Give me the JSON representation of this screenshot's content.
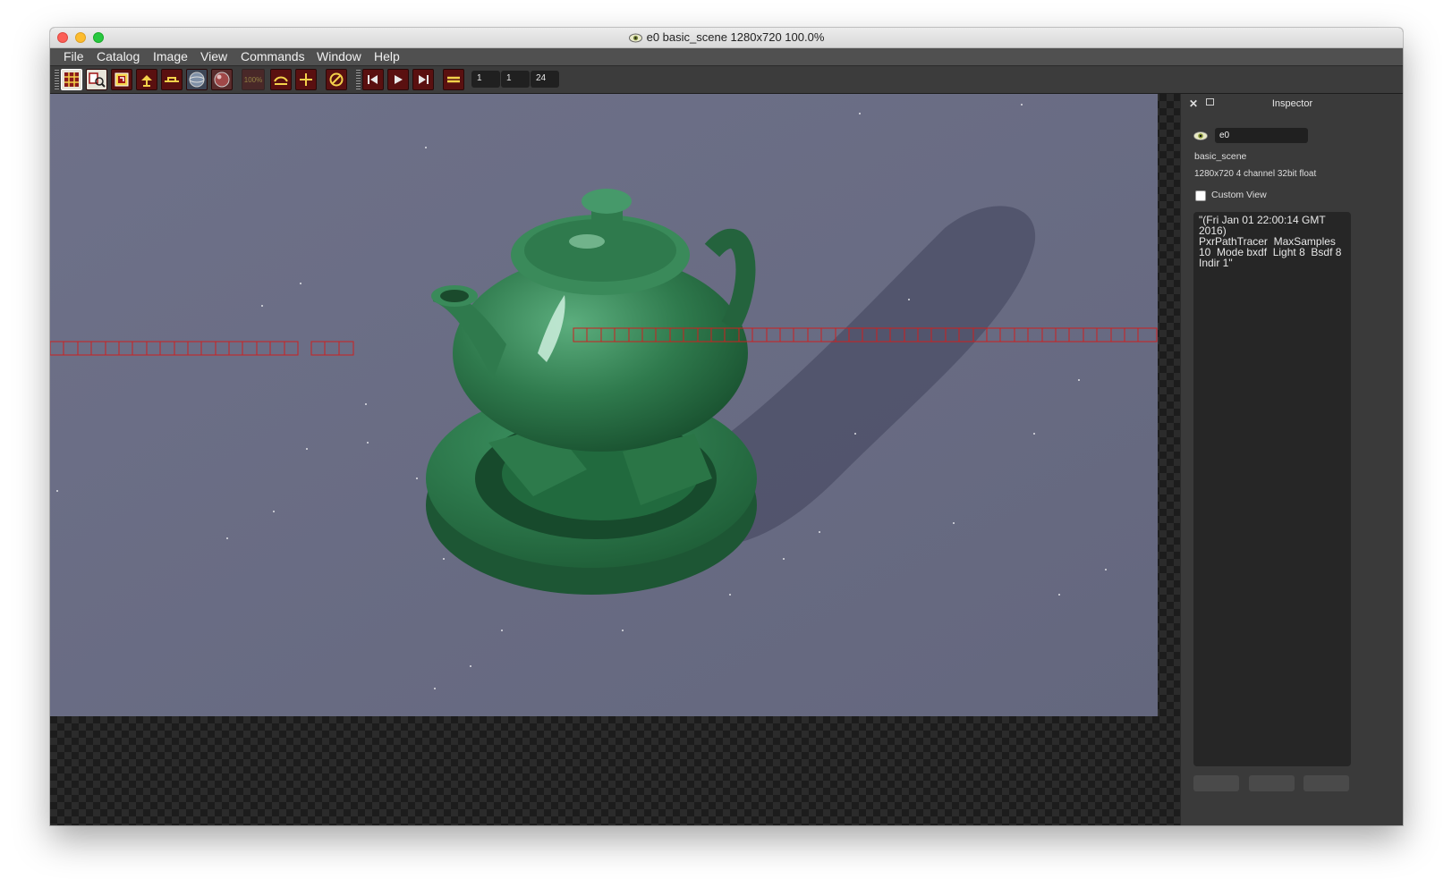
{
  "window": {
    "title": "e0 basic_scene 1280x720 100.0%"
  },
  "menu": [
    "File",
    "Catalog",
    "Image",
    "View",
    "Commands",
    "Window",
    "Help"
  ],
  "toolbar": {
    "icons": [
      "grid-view-icon",
      "catalog-search-icon",
      "snapshot-icon",
      "light-icon",
      "horizon-icon",
      "sphere-icon",
      "sphere-alt-icon",
      "zoom-100-icon",
      "bucket-icon",
      "crosshair-icon",
      "no-color-icon",
      "first-frame-icon",
      "play-icon",
      "last-frame-icon",
      "range-icon"
    ],
    "zoom_label": "100%",
    "frame_start": "1",
    "frame_current": "1",
    "frame_end": "24"
  },
  "inspector": {
    "title": "Inspector",
    "name_value": "e0",
    "scene_name": "basic_scene",
    "image_info": "1280x720 4 channel 32bit float",
    "custom_view_label": "Custom View",
    "notes": "\"(Fri Jan 01 22:00:14 GMT 2016)\nPxrPathTracer  MaxSamples 10  Mode bxdf  Light 8  Bsdf 8  Indir 1\""
  },
  "colors": {
    "render_bg": "#6a6d85",
    "teapot_green": "#2f7a4d",
    "bucket_red": "#cc2020"
  }
}
